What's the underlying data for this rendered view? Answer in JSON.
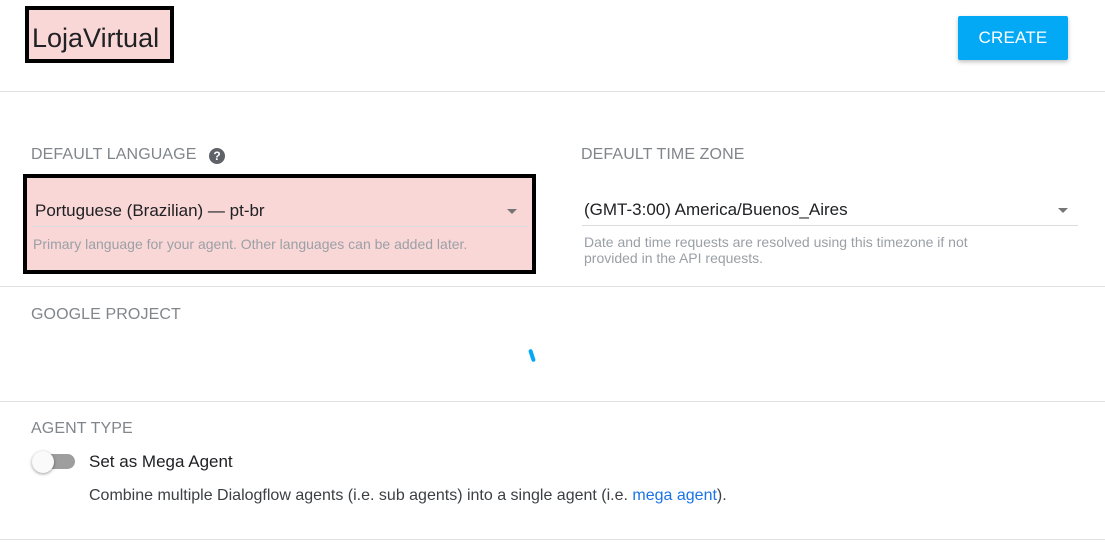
{
  "header": {
    "agent_name": "LojaVirtual",
    "create_label": "CREATE"
  },
  "language": {
    "label": "DEFAULT LANGUAGE",
    "help_icon": "question-circle-icon",
    "value": "Portuguese (Brazilian) — pt-br",
    "hint": "Primary language for your agent. Other languages can be added later."
  },
  "timezone": {
    "label": "DEFAULT TIME ZONE",
    "value": "(GMT-3:00) America/Buenos_Aires",
    "hint_line1": "Date and time requests are resolved using this timezone if not",
    "hint_line2": "provided in the API requests."
  },
  "google_project": {
    "label": "GOOGLE PROJECT"
  },
  "agent_type": {
    "label": "AGENT TYPE",
    "toggle_label": "Set as Mega Agent",
    "toggle_on": false,
    "desc_prefix": "Combine multiple Dialogflow agents (i.e. sub agents) into a single agent (i.e. ",
    "desc_link": "mega agent",
    "desc_suffix": ")."
  },
  "colors": {
    "accent": "#03a9f4",
    "highlight": "#fad7d7",
    "link": "#1a73e8"
  }
}
